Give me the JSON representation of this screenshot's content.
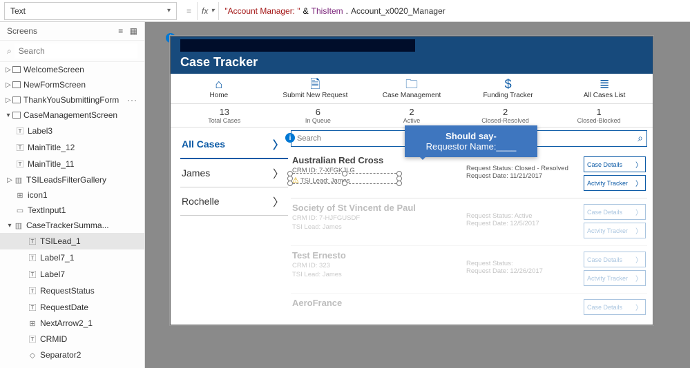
{
  "property_dropdown": "Text",
  "equals": "=",
  "fx_label": "fx",
  "formula": {
    "str": "\"Account Manager: \"",
    "amp": "&",
    "obj": "ThisItem",
    "dot": ".",
    "fld": "Account_x0020_Manager"
  },
  "tree": {
    "title": "Screens",
    "search_placeholder": "Search",
    "items": {
      "welcome": "WelcomeScreen",
      "newform": "NewFormScreen",
      "thankyou": "ThankYouSubmittingForm",
      "thankyou_dots": "···",
      "casemgmt": "CaseManagementScreen",
      "label3": "Label3",
      "mt12": "MainTitle_12",
      "mt11": "MainTitle_11",
      "tsileads": "TSILeadsFilterGallery",
      "icon1": "icon1",
      "textinput1": "TextInput1",
      "casetracker": "CaseTrackerSumma...",
      "tsilead1": "TSILead_1",
      "label7_1": "Label7_1",
      "label7": "Label7",
      "reqstatus": "RequestStatus",
      "reqdate": "RequestDate",
      "nextarrow": "NextArrow2_1",
      "crmid": "CRMID",
      "sep2": "Separator2"
    }
  },
  "app": {
    "title": "Case Tracker",
    "nav": {
      "home": "Home",
      "submit": "Submit New Request",
      "casemgmt": "Case Management",
      "funding": "Funding Tracker",
      "allcases": "All Cases List"
    },
    "stats": {
      "s0n": "13",
      "s0l": "Total Cases",
      "s1n": "6",
      "s1l": "In Queue",
      "s2n": "2",
      "s2l": "Active",
      "s3n": "2",
      "s3l": "Closed-Resolved",
      "s4n": "1",
      "s4l": "Closed-Blocked"
    },
    "filters": {
      "f0": "All Cases",
      "f1": "James",
      "f2": "Rochelle"
    },
    "search_placeholder": "Search",
    "btn_details": "Case Details",
    "btn_activity": "Actvity Tracker",
    "cards": {
      "c0": {
        "title": "Australian Red Cross",
        "crm": "CRM ID: 7-XFGKJLG",
        "lead": "TSI Lead: James",
        "status": "Request Status: Closed - Resolved",
        "date": "Request Date: 11/21/2017"
      },
      "c1": {
        "title": "Society of St Vincent de Paul",
        "crm": "CRM ID: 7-HJFGUSDF",
        "lead": "TSI Lead: James",
        "status": "Request Status: Active",
        "date": "Request Date: 12/5/2017"
      },
      "c2": {
        "title": "Test Ernesto",
        "crm": "CRM ID: 323",
        "lead": "TSI Lead: James",
        "status": "Request Status:",
        "date": "Request Date: 12/26/2017"
      },
      "c3": {
        "title": "AeroFrance"
      }
    }
  },
  "tooltip": {
    "l1": "Should say-",
    "l2": "Requestor Name:____"
  }
}
